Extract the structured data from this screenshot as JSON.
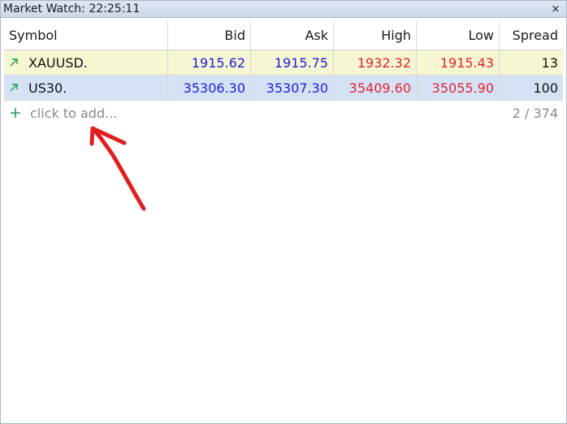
{
  "window": {
    "title_prefix": "Market Watch:",
    "time": "22:25:11",
    "close_glyph": "×"
  },
  "columns": {
    "symbol": "Symbol",
    "bid": "Bid",
    "ask": "Ask",
    "high": "High",
    "low": "Low",
    "spread": "Spread"
  },
  "rows": [
    {
      "symbol": "XAUUSD.",
      "bid": "1915.62",
      "ask": "1915.75",
      "high": "1932.32",
      "low": "1915.43",
      "spread": "13",
      "direction_icon": "arrow-up-right-icon"
    },
    {
      "symbol": "US30.",
      "bid": "35306.30",
      "ask": "35307.30",
      "high": "35409.60",
      "low": "35055.90",
      "spread": "100",
      "direction_icon": "arrow-up-right-icon"
    }
  ],
  "add_row": {
    "placeholder": "click to add...",
    "count": "2 / 374",
    "icon": "plus-icon"
  },
  "colors": {
    "row_highlight_1": "#f6f6d2",
    "row_highlight_2": "#d5e2f6",
    "price_blue": "#1d1ddb",
    "price_red": "#e3242b",
    "arrow_green": "#16a34a",
    "annotation_red": "#e11d1d"
  }
}
